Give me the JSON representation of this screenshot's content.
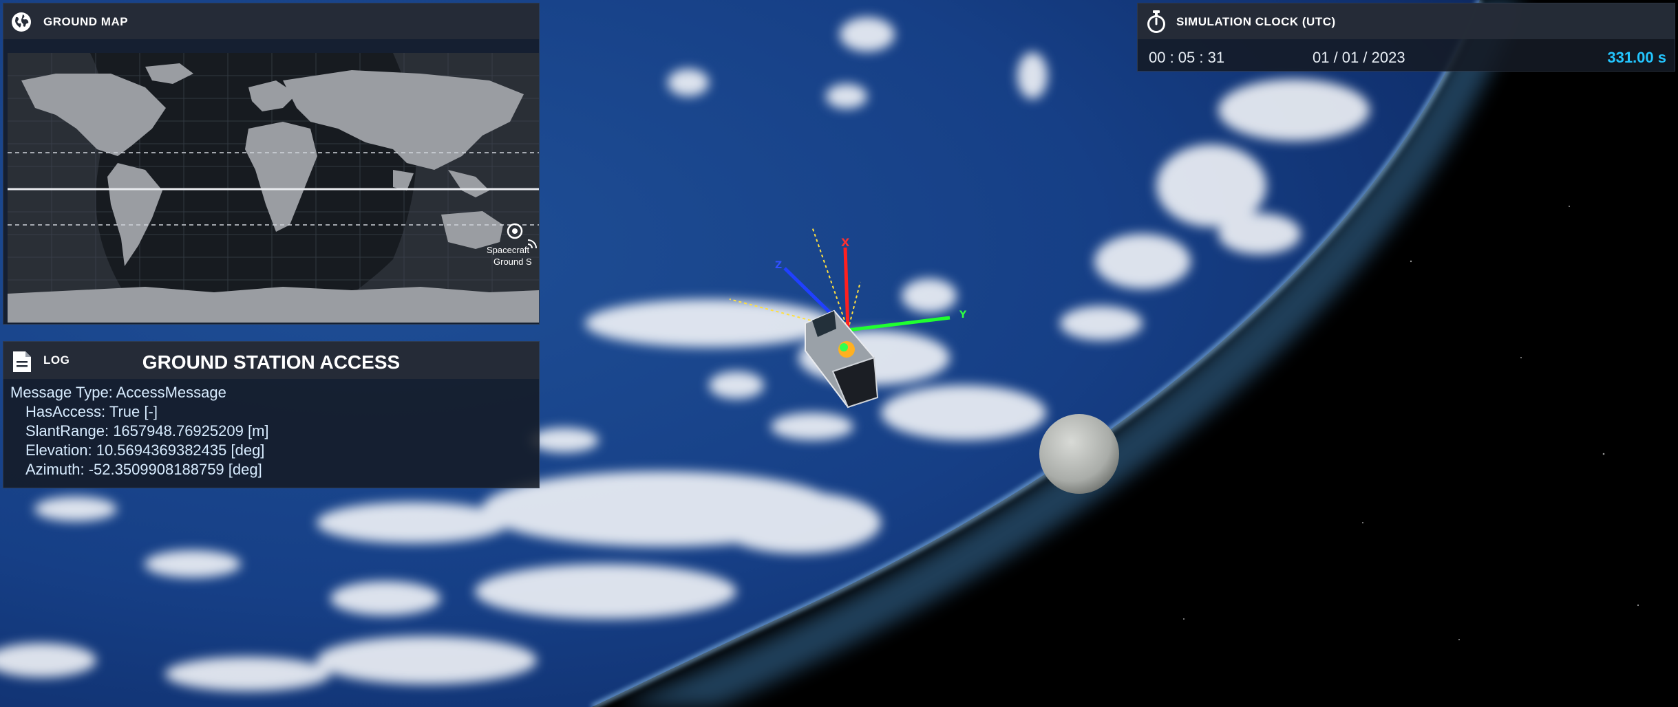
{
  "ground_map": {
    "title": "GROUND MAP",
    "icon": "globe-icon",
    "marker_label_line1": "Spacecraft",
    "marker_label_line2": "Ground S"
  },
  "log": {
    "title": "LOG",
    "icon": "document-icon",
    "heading": "GROUND STATION ACCESS",
    "lines": [
      "Message Type: AccessMessage",
      "HasAccess:  True  [-]",
      "SlantRange:  1657948.76925209  [m]",
      "Elevation:  10.5694369382435  [deg]",
      "Azimuth:  -52.3509908188759  [deg]"
    ]
  },
  "clock": {
    "title": "SIMULATION CLOCK (UTC)",
    "icon": "stopwatch-icon",
    "time": "00 : 05 : 31",
    "date": "01 / 01 / 2023",
    "sim_time": "331.00 s"
  },
  "scene": {
    "axis_labels": {
      "x": "X",
      "y": "Y",
      "z": "Z"
    },
    "colors": {
      "axis_x": "#ff2020",
      "axis_y": "#20ff30",
      "axis_z": "#2040ff",
      "accent": "#23c6ff"
    }
  }
}
